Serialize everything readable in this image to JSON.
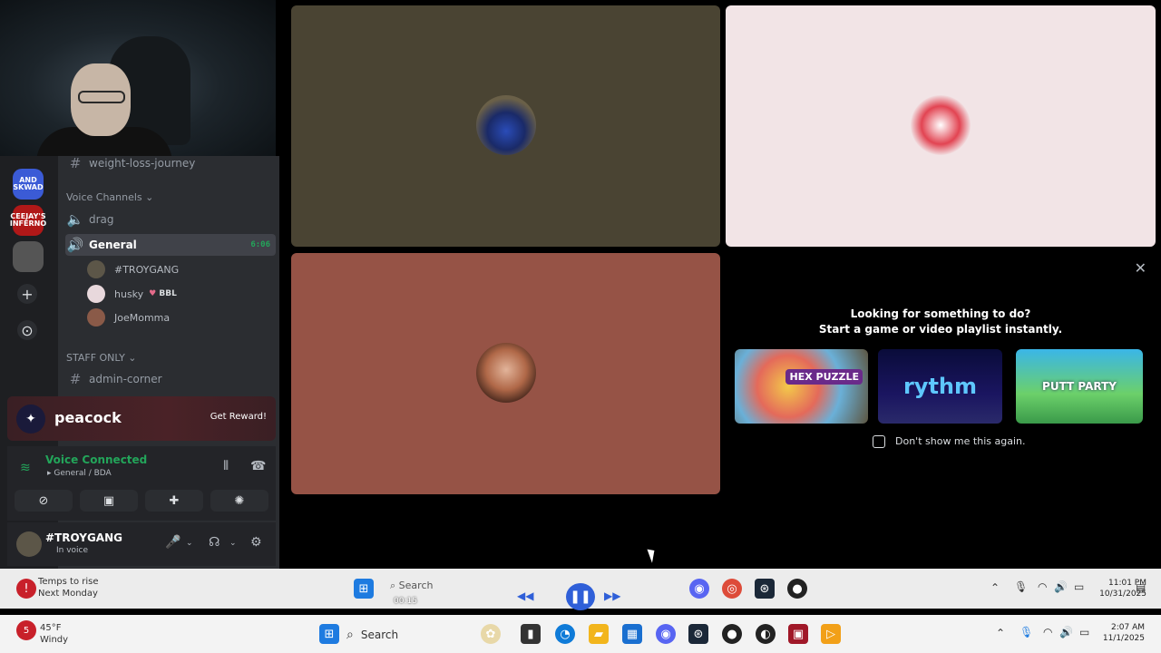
{
  "sidebar": {
    "channels_top": [
      {
        "label": "weight-loss-journey"
      }
    ],
    "voice_category": "Voice Channels",
    "voice_channels": [
      {
        "label": "drag"
      },
      {
        "label": "General",
        "timer": "6:06"
      }
    ],
    "voice_users": [
      {
        "name": "#TROYGANG"
      },
      {
        "name": "husky",
        "badge": "BBL"
      },
      {
        "name": "JoeMomma"
      }
    ],
    "staff_category": "STAFF ONLY",
    "staff_channels": [
      {
        "label": "admin-corner"
      }
    ]
  },
  "servers": [
    {
      "label": "AND SKWAD",
      "color": "#3b5bd6"
    },
    {
      "label": "CEEJAY'S INFERNO",
      "color": "#b01818"
    },
    {
      "label": "",
      "color": "#555555"
    }
  ],
  "promo": {
    "brand": "peacock",
    "cta": "Get Reward!"
  },
  "voice": {
    "status": "Voice Connected",
    "location": "General / BDA"
  },
  "user": {
    "name": "#TROYGANG",
    "status": "In voice"
  },
  "activity": {
    "line1": "Looking for something to do?",
    "line2": "Start a game or video playlist instantly.",
    "cards": [
      {
        "label": "HEX PUZZLE"
      },
      {
        "label": "rythm"
      },
      {
        "label": "PUTT PARTY"
      }
    ],
    "checkbox_label": "Don't show me this again."
  },
  "taskbar_top": {
    "weather_line1": "Temps to rise",
    "weather_line2": "Next Monday",
    "search": "Search",
    "player_time": "00:15",
    "clock_time": "11:01 PM",
    "clock_date": "10/31/2025"
  },
  "taskbar_bottom": {
    "weather_temp": "45°F",
    "weather_cond": "Windy",
    "search": "Search",
    "clock_time": "2:07 AM",
    "clock_date": "11/1/2025"
  },
  "colors": {
    "tile_top_left": "#4a4433",
    "tile_top_right": "#f2e4e6",
    "tile_bottom_left": "#965346",
    "voice_green": "#23a55a"
  }
}
